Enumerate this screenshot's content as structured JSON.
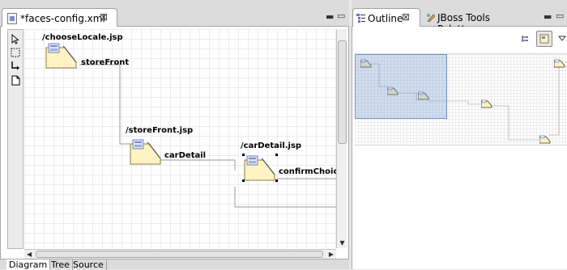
{
  "editor": {
    "tab_title": "*faces-config.xml",
    "tab_close_glyph": "⊠",
    "minimize_glyph": "▭",
    "maximize_glyph": "▭",
    "tools": [
      "select-arrow-icon",
      "marquee-icon",
      "connection-icon",
      "page-icon"
    ],
    "bottom_tabs": [
      {
        "label": "Diagram",
        "active": true
      },
      {
        "label": "Tree",
        "active": false
      },
      {
        "label": "Source",
        "active": false
      }
    ],
    "diagram": {
      "nodes": [
        {
          "title": "/chooseLocale.jsp",
          "case_label": "storeFront"
        },
        {
          "title": "/storeFront.jsp",
          "case_label": "carDetail"
        },
        {
          "title": "/carDetail.jsp",
          "case_label": "confirmChoice"
        }
      ]
    }
  },
  "outline_view": {
    "tabs": [
      {
        "label": "Outline",
        "active": true,
        "icon": "outline-icon"
      },
      {
        "label": "JBoss Tools Palette",
        "active": false,
        "icon": "palette-icon"
      }
    ],
    "tab_close_glyph": "⊠",
    "toolbar": [
      "tree-view-icon",
      "overview-icon",
      "view-menu-icon"
    ]
  },
  "colors": {
    "page_fill": "#fff3c4",
    "page_border": "#8a7d3f",
    "viewport_fill": "#a5c0e0",
    "connector": "#9a9a9a"
  }
}
